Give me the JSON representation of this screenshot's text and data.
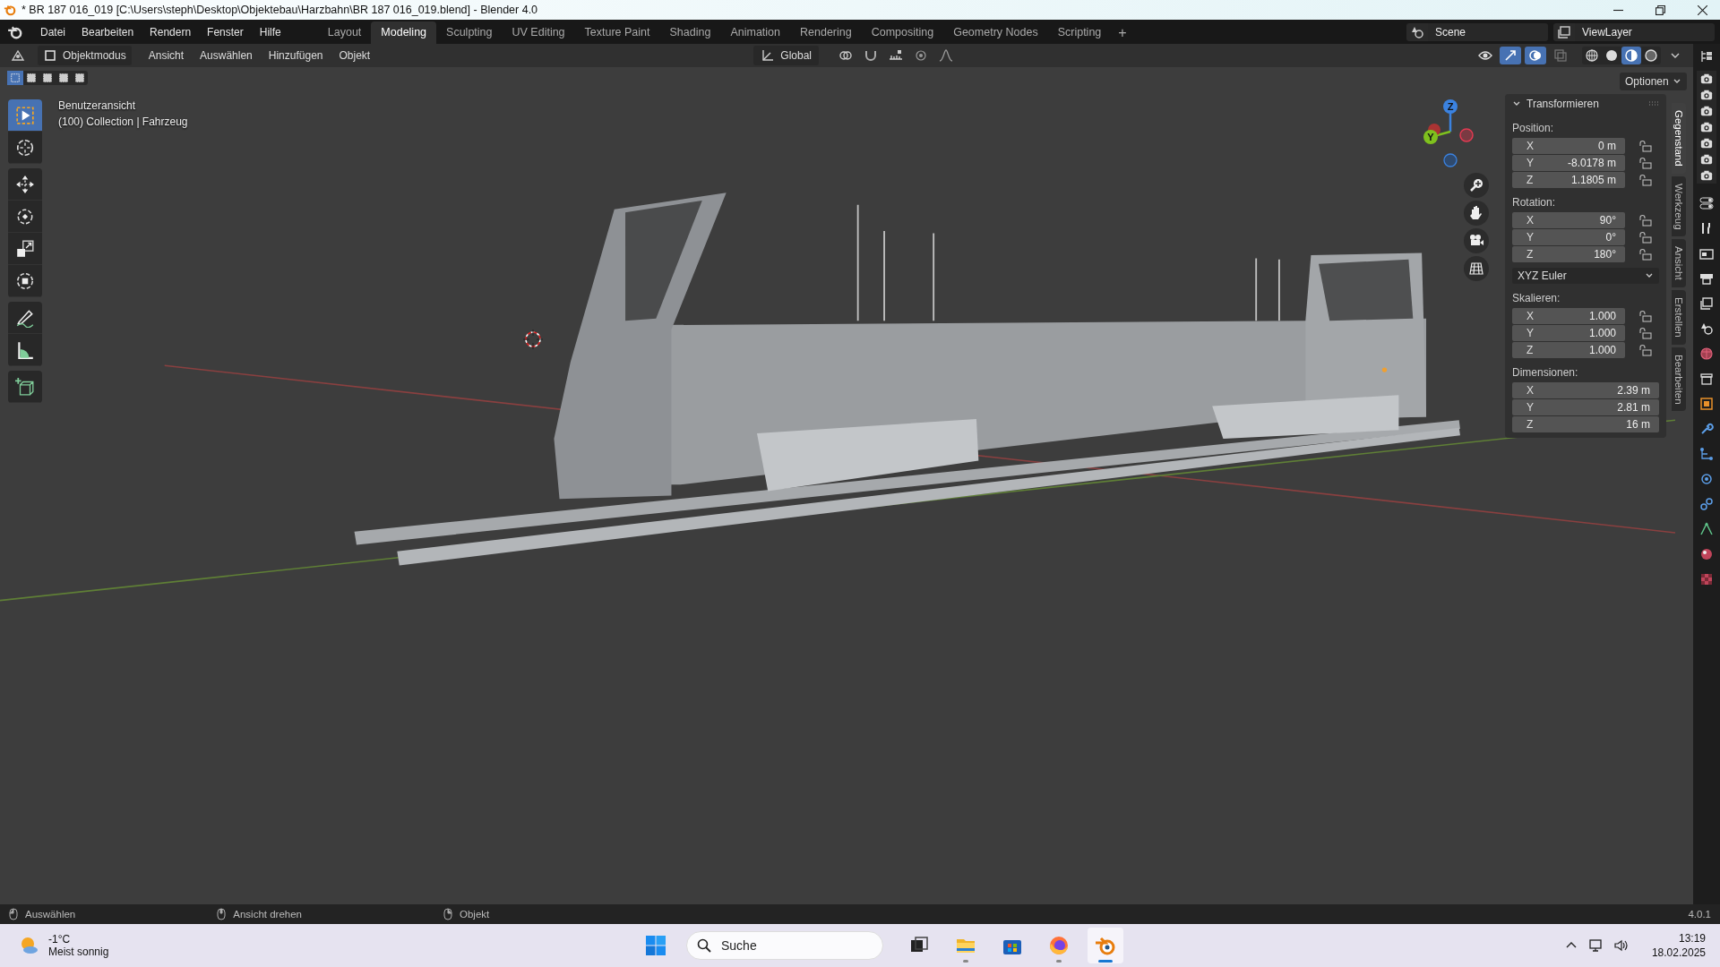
{
  "title_bar": {
    "title": "* BR 187 016_019 [C:\\Users\\steph\\Desktop\\Objektebau\\Harzbahn\\BR 187 016_019.blend] - Blender 4.0"
  },
  "menu": [
    "Datei",
    "Bearbeiten",
    "Rendern",
    "Fenster",
    "Hilfe"
  ],
  "workspace_tabs": [
    {
      "label": "Layout",
      "selected": false
    },
    {
      "label": "Modeling",
      "selected": true
    },
    {
      "label": "Sculpting",
      "selected": false
    },
    {
      "label": "UV Editing",
      "selected": false
    },
    {
      "label": "Texture Paint",
      "selected": false
    },
    {
      "label": "Shading",
      "selected": false
    },
    {
      "label": "Animation",
      "selected": false
    },
    {
      "label": "Rendering",
      "selected": false
    },
    {
      "label": "Compositing",
      "selected": false
    },
    {
      "label": "Geometry Nodes",
      "selected": false
    },
    {
      "label": "Scripting",
      "selected": false
    }
  ],
  "add_tab": "+",
  "scene": "Scene",
  "view_layer": "ViewLayer",
  "header": {
    "mode": "Objektmodus",
    "menus": [
      "Ansicht",
      "Auswählen",
      "Hinzufügen",
      "Objekt"
    ],
    "orientation": "Global"
  },
  "shading_modes": [
    {
      "kind": "wireframe",
      "selected": false
    },
    {
      "kind": "solid",
      "selected": false
    },
    {
      "kind": "material",
      "selected": true
    },
    {
      "kind": "rendered",
      "selected": false
    }
  ],
  "selection_modes": [
    {
      "selected": true
    },
    {
      "selected": false
    },
    {
      "selected": false
    },
    {
      "selected": false
    },
    {
      "selected": false
    }
  ],
  "options_button": "Optionen",
  "viewport": {
    "view_name": "Benutzeransicht",
    "collection_line": "(100) Collection | Fahrzeug",
    "gizmo_labels": [
      "Z",
      "Y"
    ]
  },
  "tool_groups": [
    [
      {
        "kind": "select",
        "selected": true
      },
      {
        "kind": "cursor",
        "selected": false
      }
    ],
    [
      {
        "kind": "move",
        "selected": false
      },
      {
        "kind": "rotate",
        "selected": false
      },
      {
        "kind": "scale",
        "selected": false
      },
      {
        "kind": "transform",
        "selected": false
      }
    ],
    [
      {
        "kind": "annotate",
        "selected": false
      },
      {
        "kind": "measure",
        "selected": false
      }
    ],
    [
      {
        "kind": "add-cube",
        "selected": false
      }
    ]
  ],
  "transform_panel": {
    "title": "Transformieren",
    "sections": [
      {
        "kind": "vector",
        "label": "Position:",
        "fields": [
          {
            "axis": "X",
            "value": "0 m",
            "locked": false
          },
          {
            "axis": "Y",
            "value": "-8.0178 m",
            "locked": false
          },
          {
            "axis": "Z",
            "value": "1.1805 m",
            "locked": false
          }
        ]
      },
      {
        "kind": "vector",
        "label": "Rotation:",
        "fields": [
          {
            "axis": "X",
            "value": "90°",
            "locked": false
          },
          {
            "axis": "Y",
            "value": "0°",
            "locked": false
          },
          {
            "axis": "Z",
            "value": "180°",
            "locked": false
          }
        ]
      },
      {
        "kind": "dropdown",
        "value": "XYZ Euler"
      },
      {
        "kind": "vector",
        "label": "Skalieren:",
        "fields": [
          {
            "axis": "X",
            "value": "1.000",
            "locked": false
          },
          {
            "axis": "Y",
            "value": "1.000",
            "locked": false
          },
          {
            "axis": "Z",
            "value": "1.000",
            "locked": false
          }
        ]
      },
      {
        "kind": "plain",
        "label": "Dimensionen:",
        "fields": [
          {
            "axis": "X",
            "value": "2.39 m"
          },
          {
            "axis": "Y",
            "value": "2.81 m"
          },
          {
            "axis": "Z",
            "value": "16 m"
          }
        ]
      }
    ]
  },
  "sidebar_tabs": [
    {
      "label": "Gegenstand",
      "selected": true
    },
    {
      "label": "Werkzeug",
      "selected": false
    },
    {
      "label": "Ansicht",
      "selected": false
    },
    {
      "label": "Erstellen",
      "selected": false
    },
    {
      "label": "Bearbeiten",
      "selected": false
    }
  ],
  "status_bar": {
    "items": [
      "Auswählen",
      "Ansicht drehen",
      "Objekt"
    ],
    "version": "4.0.1"
  },
  "taskbar": {
    "temperature": "-1°C",
    "weather": "Meist sonnig",
    "search_placeholder": "Suche",
    "apps": [
      {
        "kind": "task-view",
        "running": false,
        "active": false
      },
      {
        "kind": "folder",
        "running": true,
        "active": false
      },
      {
        "kind": "store",
        "running": false,
        "active": false
      },
      {
        "kind": "browser",
        "running": true,
        "active": false
      },
      {
        "kind": "blender",
        "running": true,
        "active": true
      }
    ],
    "time": "13:19",
    "date": "18.02.2025"
  }
}
